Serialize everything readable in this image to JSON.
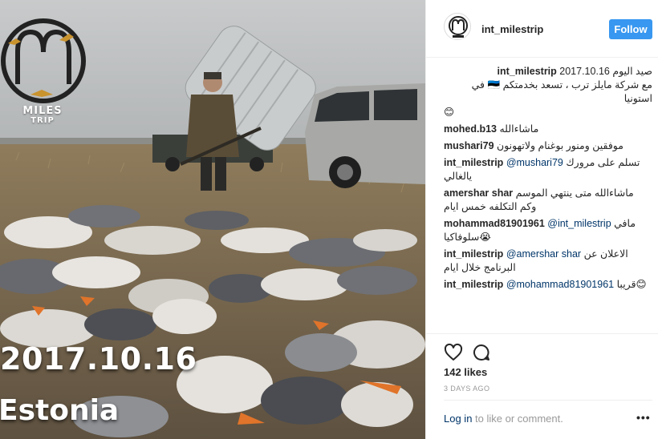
{
  "photo": {
    "logo_line1": "MILES",
    "logo_line2": "TRIP",
    "overlay_date": "2017.10.16",
    "overlay_place": "Estonia"
  },
  "header": {
    "username": "int_milestrip",
    "follow_label": "Follow"
  },
  "caption": {
    "user": "int_milestrip",
    "text_line1": "2017.10.16 صيد اليوم",
    "text_line2": "مع شركة مايلز ترب ، تسعد بخدمتكم 🇪🇪 في استونيا",
    "emoji": "😊"
  },
  "comments": [
    {
      "user": "mohed.b13",
      "text": "ماشاءالله"
    },
    {
      "user": "mushari79",
      "text": "موفقين ومنور بوغنام ولاتهونون"
    },
    {
      "user": "int_milestrip",
      "mention": "@mushari79",
      "text": "تسلم على مرورك يالغالي"
    },
    {
      "user": "amershar shar",
      "text": "ماشاءالله متى ينتهي الموسم وكم التكلفه خمس ايام"
    },
    {
      "user": "mohammad81901961",
      "mention": "@int_milestrip",
      "text": "مافي سلوفاكيا😭"
    },
    {
      "user": "int_milestrip",
      "mention": "@amershar shar",
      "text": "الاعلان عن البرنامج خلال ايام"
    },
    {
      "user": "int_milestrip",
      "mention": "@mohammad81901961",
      "text": "قريبا😊"
    }
  ],
  "actions": {
    "likes": "142 likes",
    "ago": "3 DAYS AGO",
    "login_link": "Log in",
    "login_rest": " to like or comment.",
    "more": "•••"
  },
  "colors": {
    "accent": "#3897f0",
    "link": "#003569",
    "muted": "#999999"
  },
  "icons": [
    "heart-icon",
    "comment-icon",
    "more-options-icon"
  ]
}
